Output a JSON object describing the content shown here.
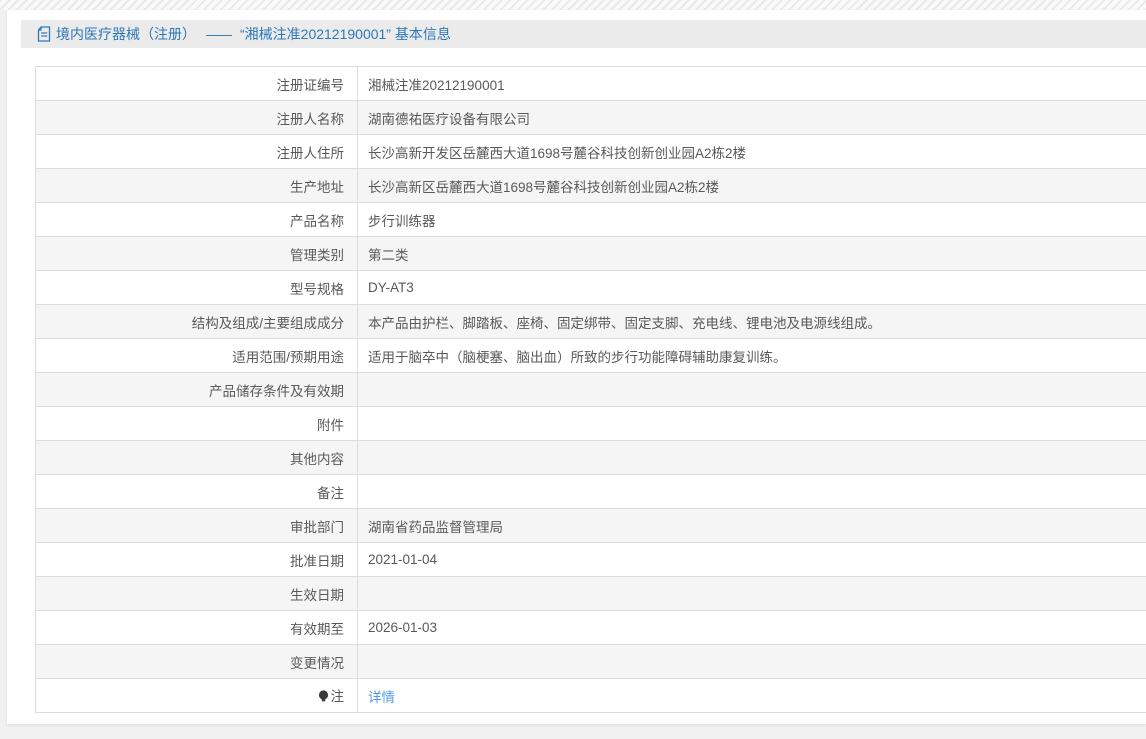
{
  "header": {
    "title_prefix": "境内医疗器械（注册）",
    "separator": "——",
    "title_suffix": "“湘械注准20212190001” 基本信息"
  },
  "colors": {
    "accent_blue": "#2d78b8",
    "link_blue": "#4d9ce6",
    "row_alt": "#f5f5f5",
    "border": "#dcdcdc"
  },
  "icons": {
    "title": "document-icon",
    "note_row": "bulb-icon"
  },
  "table": {
    "rows": [
      {
        "label": "注册证编号",
        "value": "湘械注准20212190001"
      },
      {
        "label": "注册人名称",
        "value": "湖南德祐医疗设备有限公司"
      },
      {
        "label": "注册人住所",
        "value": "长沙高新开发区岳麓西大道1698号麓谷科技创新创业园A2栋2楼"
      },
      {
        "label": "生产地址",
        "value": "长沙高新区岳麓西大道1698号麓谷科技创新创业园A2栋2楼"
      },
      {
        "label": "产品名称",
        "value": "步行训练器"
      },
      {
        "label": "管理类别",
        "value": "第二类"
      },
      {
        "label": "型号规格",
        "value": "DY-AT3"
      },
      {
        "label": "结构及组成/主要组成成分",
        "value": "本产品由护栏、脚踏板、座椅、固定绑带、固定支脚、充电线、锂电池及电源线组成。"
      },
      {
        "label": "适用范围/预期用途",
        "value": "适用于脑卒中（脑梗塞、脑出血）所致的步行功能障碍辅助康复训练。"
      },
      {
        "label": "产品储存条件及有效期",
        "value": ""
      },
      {
        "label": "附件",
        "value": ""
      },
      {
        "label": "其他内容",
        "value": ""
      },
      {
        "label": "备注",
        "value": ""
      },
      {
        "label": "审批部门",
        "value": "湖南省药品监督管理局"
      },
      {
        "label": "批准日期",
        "value": "2021-01-04"
      },
      {
        "label": "生效日期",
        "value": ""
      },
      {
        "label": "有效期至",
        "value": "2026-01-03"
      },
      {
        "label": "变更情况",
        "value": ""
      },
      {
        "label": "注",
        "value": "详情",
        "icon": "bulb-icon",
        "value_is_link": true
      }
    ]
  }
}
